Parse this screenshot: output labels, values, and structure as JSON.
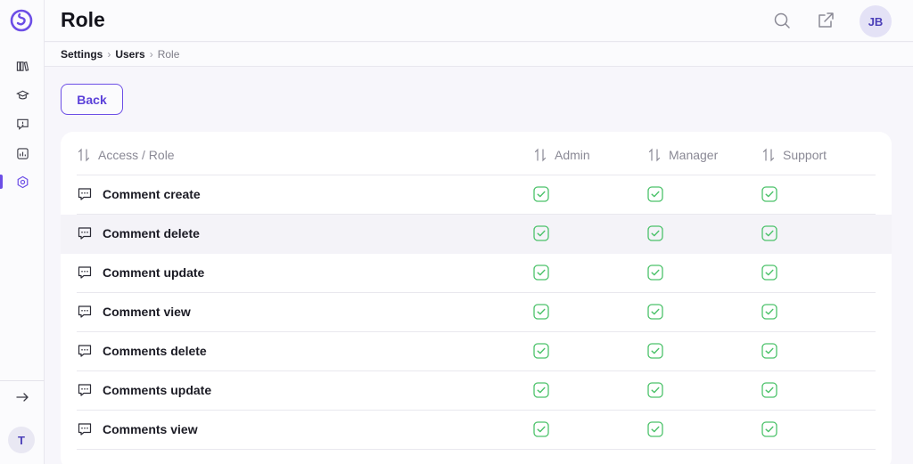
{
  "header": {
    "title": "Role",
    "avatar_initials": "JB"
  },
  "breadcrumb": {
    "items": [
      "Settings",
      "Users",
      "Role"
    ]
  },
  "back_label": "Back",
  "sidebar": {
    "items": [
      {
        "icon": "library-icon"
      },
      {
        "icon": "graduation-cap-icon"
      },
      {
        "icon": "help-chat-icon"
      },
      {
        "icon": "analytics-icon"
      },
      {
        "icon": "settings-icon",
        "active": true
      }
    ],
    "user_initial": "T"
  },
  "table": {
    "columns": [
      "Access / Role",
      "Admin",
      "Manager",
      "Support"
    ],
    "rows": [
      {
        "label": "Comment create",
        "admin": true,
        "manager": true,
        "support": true
      },
      {
        "label": "Comment delete",
        "admin": true,
        "manager": true,
        "support": true
      },
      {
        "label": "Comment update",
        "admin": true,
        "manager": true,
        "support": true
      },
      {
        "label": "Comment view",
        "admin": true,
        "manager": true,
        "support": true
      },
      {
        "label": "Comments delete",
        "admin": true,
        "manager": true,
        "support": true
      },
      {
        "label": "Comments update",
        "admin": true,
        "manager": true,
        "support": true
      },
      {
        "label": "Comments view",
        "admin": true,
        "manager": true,
        "support": true
      }
    ]
  },
  "colors": {
    "accent": "#6c4ee6",
    "check_green": "#4cc26a"
  }
}
